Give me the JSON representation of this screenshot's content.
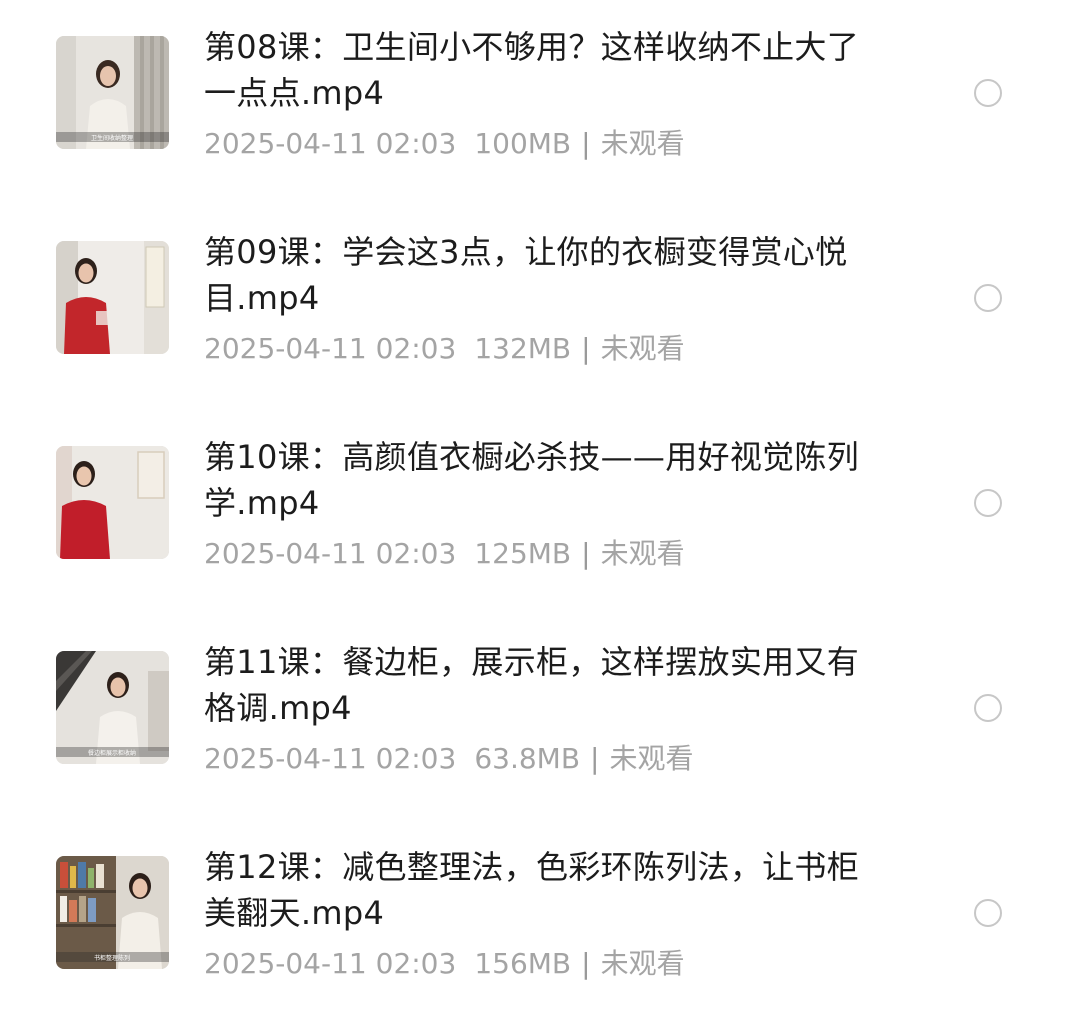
{
  "files": [
    {
      "title": "第08课：卫生间小不够用？这样收纳不止大了一点点.mp4",
      "date": "2025-04-11 02:03",
      "size": "100MB",
      "status": "未观看",
      "thumb_caption": "卫生间收纳整理"
    },
    {
      "title": "第09课：学会这3点，让你的衣橱变得赏心悦目.mp4",
      "date": "2025-04-11 02:03",
      "size": "132MB",
      "status": "未观看",
      "thumb_caption": ""
    },
    {
      "title": "第10课：高颜值衣橱必杀技——用好视觉陈列学.mp4",
      "date": "2025-04-11 02:03",
      "size": "125MB",
      "status": "未观看",
      "thumb_caption": ""
    },
    {
      "title": "第11课：餐边柜，展示柜，这样摆放实用又有格调.mp4",
      "date": "2025-04-11 02:03",
      "size": "63.8MB",
      "status": "未观看",
      "thumb_caption": "餐边柜展示柜收纳"
    },
    {
      "title": "第12课：减色整理法，色彩环陈列法，让书柜美翻天.mp4",
      "date": "2025-04-11 02:03",
      "size": "156MB",
      "status": "未观看",
      "thumb_caption": "书柜整理陈列"
    }
  ],
  "icons": {
    "select": "radio-circle-icon"
  },
  "colors": {
    "title": "#1c1c1c",
    "meta": "#a4a4a4",
    "radio_border": "#c7c7c7"
  }
}
